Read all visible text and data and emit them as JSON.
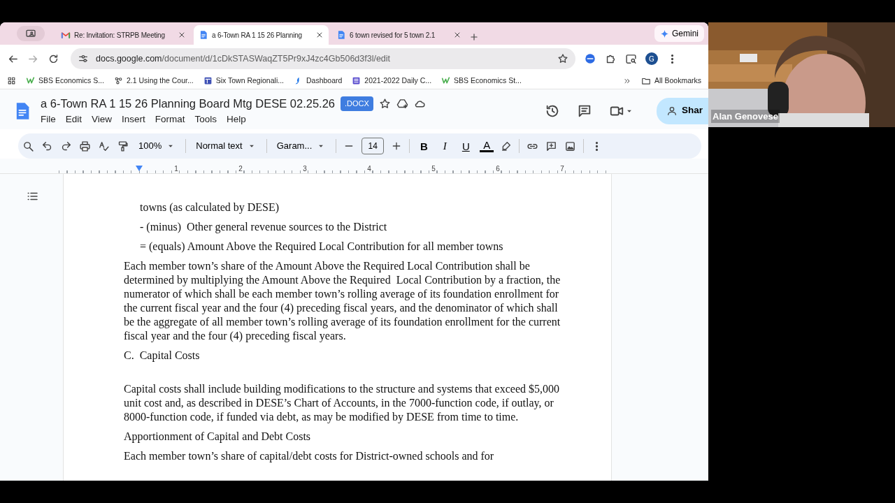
{
  "browser": {
    "tabs": [
      {
        "kind": "gmail",
        "title": "Re: Invitation: STRPB Meeting",
        "selected": false
      },
      {
        "kind": "docs",
        "title": "a 6-Town RA 1 15 26 Planning",
        "selected": true
      },
      {
        "kind": "docs",
        "title": "6 town revised for 5 town 2.1",
        "selected": false
      }
    ],
    "gemini": "Gemini",
    "url": {
      "host": "docs.google.com",
      "path": "/document/d/1cDkSTASWaqZT5Pr9xJ4zc4Gb506d3f3l/edit"
    },
    "profile": "G",
    "bookmarks": [
      {
        "kind": "w",
        "label": "SBS Economics S..."
      },
      {
        "kind": "nodes",
        "label": "2.1 Using the Cour..."
      },
      {
        "kind": "board",
        "label": "Six Town Regionali..."
      },
      {
        "kind": "dash",
        "label": "Dashboard"
      },
      {
        "kind": "list",
        "label": "2021-2022 Daily C..."
      },
      {
        "kind": "w",
        "label": "SBS Economics St..."
      }
    ],
    "all_bookmarks": "All Bookmarks"
  },
  "doc": {
    "title": "a 6-Town RA 1 15 26 Planning Board Mtg DESE 02.25.26",
    "badge": ".DOCX",
    "menu": [
      "File",
      "Edit",
      "View",
      "Insert",
      "Format",
      "Tools",
      "Help"
    ],
    "share": "Shar",
    "toolbar": {
      "zoom": "100%",
      "style": "Normal text",
      "font": "Garam...",
      "size": "14",
      "format": [
        "B",
        "I",
        "U",
        "A"
      ]
    },
    "ruler": [
      "1",
      "2",
      "3",
      "4",
      "5",
      "6",
      "7"
    ],
    "blocks": [
      {
        "kind": "indent",
        "text": "towns (as calculated by DESE)"
      },
      {
        "kind": "indent",
        "text": "- (minus)  Other general revenue sources to the District"
      },
      {
        "kind": "indent",
        "text": "= (equals) Amount Above the Required Local Contribution for all member towns"
      },
      {
        "kind": "body",
        "text": "Each member town’s share of the Amount Above the Required Local Contribution shall be determined by multiplying the Amount Above the Required  Local Contribution by a fraction, the numerator of which shall be each member town’s rolling average of its foundation enrollment for the current fiscal year and the four (4) preceding fiscal years, and the denominator of which shall be the aggregate of all member town’s rolling average of its foundation enrollment for the current fiscal year and the four (4) preceding fiscal years."
      },
      {
        "kind": "heading",
        "text": "C.  Capital Costs"
      },
      {
        "kind": "body",
        "text": "Capital costs shall include building modifications to the structure and systems that exceed $5,000 unit cost and, as described in DESE’s Chart of Accounts, in the 7000-function code, if outlay, or 8000-function code, if funded via debt, as may be modified by DESE from time to time."
      },
      {
        "kind": "body",
        "text": "Apportionment of Capital and Debt Costs"
      },
      {
        "kind": "body",
        "text": "Each member town’s share of capital/debt costs for District-owned schools and for"
      }
    ]
  },
  "video": {
    "kind": "picture",
    "participant": "Alan Genovese"
  }
}
